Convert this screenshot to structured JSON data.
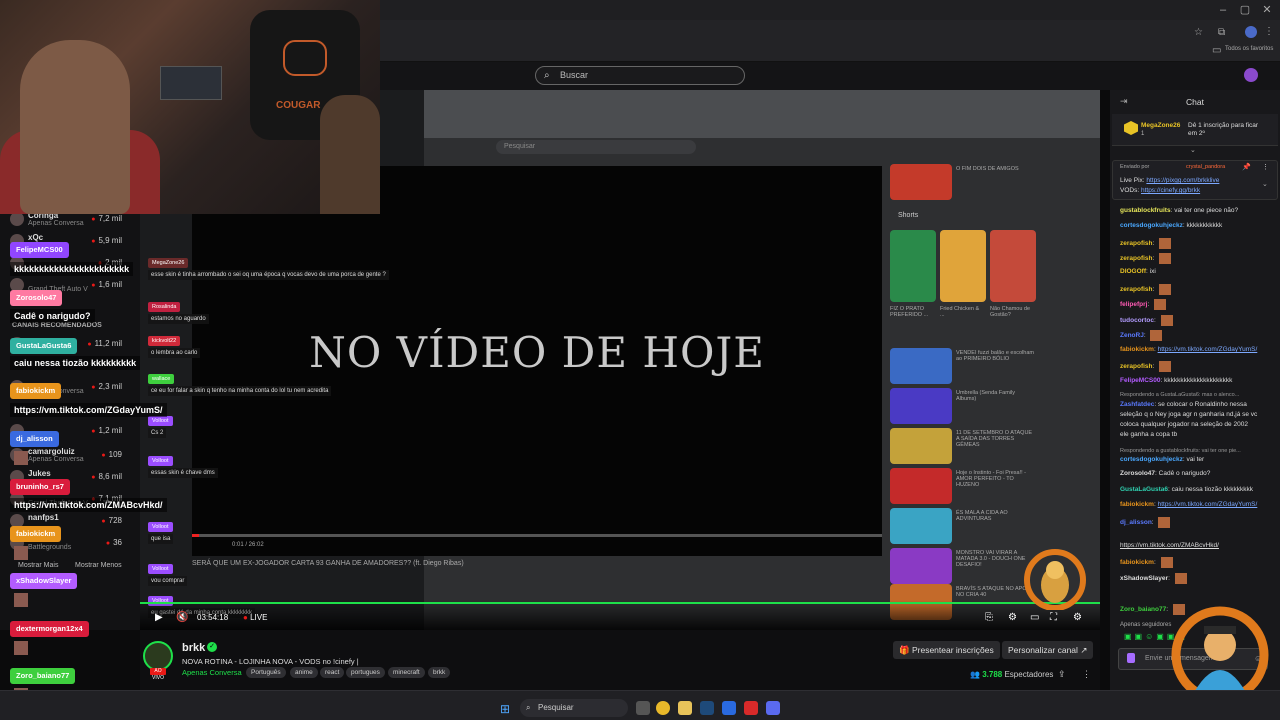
{
  "browser": {
    "window_controls": [
      "–",
      "▢",
      "✕"
    ],
    "bookmarks_label": "Todos os favoritos"
  },
  "twitch": {
    "search_placeholder": "Buscar"
  },
  "sidebar": {
    "recommended_label": "CANAIS RECOMENDADOS",
    "show_more": "Mostrar Mais",
    "show_less": "Mostrar Menos",
    "channels": [
      {
        "name": "Coringa",
        "category": "Apenas Conversa",
        "viewers": "7,2 mil"
      },
      {
        "name": "xQc",
        "category": "",
        "viewers": "5,9 mil"
      },
      {
        "name": "",
        "category": "",
        "viewers": "2 mil"
      },
      {
        "name": "",
        "category": "Grand Theft Auto V",
        "viewers": "1,6 mil"
      },
      {
        "name": "",
        "category": "",
        "viewers": "11,2 mil"
      },
      {
        "name": "",
        "category": "Apenas Conversa",
        "viewers": "2,3 mil"
      },
      {
        "name": "",
        "category": "",
        "viewers": "1,2 mil"
      },
      {
        "name": "camargoluiz",
        "category": "Apenas Conversa",
        "viewers": "109"
      },
      {
        "name": "Jukes",
        "category": "",
        "viewers": "8,6 mil"
      },
      {
        "name": "",
        "category": "Grand Theft Auto V",
        "viewers": "7,1 mil"
      },
      {
        "name": "nanfps1",
        "category": "",
        "viewers": "728"
      },
      {
        "name": "",
        "category": "Battlegrounds",
        "viewers": "36"
      }
    ]
  },
  "overlay_chat": [
    {
      "user": "FelipeMCS00",
      "color": "#9146ff",
      "message": "kkkkkkkkkkkkkkkkkkkkkkk"
    },
    {
      "user": "Zorosolo47",
      "color": "#ff7aa2",
      "message": "Cadê o narigudo?"
    },
    {
      "user": "GustaLaGusta6",
      "color": "#2fb0a0",
      "message": "caiu nessa tiozão kkkkkkkkk"
    },
    {
      "user": "fabiokickm",
      "color": "#e8941c",
      "message": "https://vm.tiktok.com/ZGdayYumS/"
    },
    {
      "user": "dj_alisson",
      "color": "#3a6ae0",
      "message": ""
    },
    {
      "user": "bruninho_rs7",
      "color": "#d91c3c",
      "message": "https://vm.tiktok.com/ZMABcvHkd/"
    },
    {
      "user": "fabiokickm",
      "color": "#e8941c",
      "message": ""
    },
    {
      "user": "xShadowSlayer",
      "color": "#b35cff",
      "message": ""
    },
    {
      "user": "dextermorgan12x4",
      "color": "#d91c3c",
      "message": ""
    },
    {
      "user": "Zoro_baiano77",
      "color": "#3ecf3e",
      "message": ""
    }
  ],
  "webcam": {
    "chair_brand": "COUGAR"
  },
  "stream": {
    "headline": "NO VÍDEO DE HOJE",
    "inner_search": "Pesquisar",
    "shorts_label": "Shorts",
    "video_time": "0:01 / 26:02",
    "video_caption": "SERÁ QUE UM EX-JOGADOR CARTA 93 GANHA DE AMADORES?? (ft. Diego Ribas)",
    "in_chat": [
      {
        "user": "MegaZone26",
        "color": "#6a2a2a",
        "message": "esse skin é tinha arrombado o sei oq uma época q vocas devo de uma porca de gente ?"
      },
      {
        "user": "Rosalinda",
        "color": "#c02040",
        "message": "estamos no aguardo"
      },
      {
        "user": "kickvolt22",
        "color": "#d02a3a",
        "message": "o lembra ao carlo"
      },
      {
        "user": "wallace",
        "color": "#3ecf3e",
        "message": "ce eu for falar a skin q tenho na minha conta do lol tu nem acredita"
      },
      {
        "user": "Volloot",
        "color": "#9b4dff",
        "message": "Cs 2"
      },
      {
        "user": "Volloot",
        "color": "#9b4dff",
        "message": "essas skin é chave dms"
      },
      {
        "user": "Volloot",
        "color": "#9b4dff",
        "message": "que isa"
      },
      {
        "user": "Volloot",
        "color": "#9b4dff",
        "message": "vou comprar"
      },
      {
        "user": "Volloot",
        "color": "#9b4dff",
        "message": "eu gastei dá da minha conta kkkkkkkk"
      }
    ],
    "thumbnails": [
      {
        "title": "O FIM DOIS DE AMIGOS",
        "color": "#c43a2a"
      },
      {
        "title": "VENDEI fuzzi balão e escolham ao PRIMEIRO BÓLIO",
        "color": "#3a6ac4"
      },
      {
        "title": "Umbrella (Senda Family Albums)",
        "color": "#4a3ac4"
      },
      {
        "title": "11 DE SETEMBRO O ATAQUE A SAÍDA DAS TORRES GÊMEAS",
        "color": "#c4a23a"
      },
      {
        "title": "Hoje o Instinto - Foi Presa!! - AMOR PERFEITO - TO HUZENO",
        "color": "#c42a2a"
      },
      {
        "title": "ÉS MALA A CIDA AO ADVINTURAS",
        "color": "#3aa4c4"
      },
      {
        "title": "MONSTRO VAI VIRAR A MATADA 3.0 - DOUCH ONE DESAFIO!",
        "color": "#8a3ac4"
      },
      {
        "title": "BRAVÍS S ATAQUE NO APOS NO CRIA 40",
        "color": "#c46a2a"
      }
    ],
    "shorts": [
      {
        "title": "FIZ O PRATO PREFERIDO ...",
        "color": "#2a8a4a"
      },
      {
        "title": "Fried Chicken & ...",
        "color": "#e0a43a"
      },
      {
        "title": "Não Chamou de Gostão?",
        "color": "#c44a3a"
      }
    ]
  },
  "player": {
    "time": "03:54:18",
    "live": "LIVE",
    "progress_fraction": 1.0
  },
  "channel": {
    "name": "brkk",
    "title": "NOVA ROTINA - LOJINHA NOVA - VODS no !cinefy |",
    "category": "Apenas Conversa",
    "live_badge": "AO VIVO",
    "tags": [
      "Português",
      "anime",
      "react",
      "portugues",
      "minecraft",
      "brkk"
    ],
    "subscribe_button": "Presentear inscrições",
    "customize_button": "Personalizar canal",
    "viewers_count": "3.788",
    "viewers_label": "Espectadores"
  },
  "chat": {
    "header": "Chat",
    "hype_user": "MegaZone26",
    "hype_sub": "1",
    "hype_message": "Dê 1 inscrição para ficar em 2º",
    "pinned_by": "Enviado por",
    "pinned_user": "crystal_pandora",
    "pinned_line1_label": "Live Pix:",
    "pinned_line1_link": "https://pixgg.com/brkklive",
    "pinned_line2_label": "VODs:",
    "pinned_line2_link": "https://cinefy.gg/brkk",
    "messages": [
      {
        "user": "gustablockfruits",
        "color": "#e6e65a",
        "text": "vai ter one piece não?"
      },
      {
        "user": "cortesdogokuhjeckz",
        "color": "#4aa8ff",
        "text": "kkkkkkkkkkk"
      },
      {
        "user": "zerapofish",
        "color": "#e8c326",
        "text": ""
      },
      {
        "user": "zerapofish",
        "color": "#e8c326",
        "text": ""
      },
      {
        "user": "DIOGOff",
        "color": "#e8c326",
        "text": "ixi"
      },
      {
        "user": "zerapofish",
        "color": "#e8c326",
        "text": ""
      },
      {
        "user": "felipefprj",
        "color": "#ff5ab4",
        "text": ""
      },
      {
        "user": "tudocortoc",
        "color": "#b39cff",
        "text": ""
      },
      {
        "user": "ZenoRJ",
        "color": "#5a7aff",
        "text": ""
      },
      {
        "user": "fabiokickm",
        "color": "#e8941c",
        "text": "https://vm.tiktok.com/ZGdayYumS/"
      },
      {
        "user": "zerapofish",
        "color": "#e8c326",
        "text": ""
      },
      {
        "user": "FelipeMCS00",
        "color": "#b35cff",
        "text": "kkkkkkkkkkkkkkkkkkkkk"
      },
      {
        "user": "Zashfatdec",
        "color": "#5a7aff",
        "text": "se colocar o Ronaldinho nessa"
      },
      {
        "user": "",
        "color": "#ddd",
        "text": "seleção q o Ney joga agr n ganharia nd,já se vc"
      },
      {
        "user": "",
        "color": "#ddd",
        "text": "coloca qualquer jogador na seleção de 2002"
      },
      {
        "user": "",
        "color": "#ddd",
        "text": "ele ganha a copa tb"
      },
      {
        "user": "cortesdogokuhjeckz",
        "color": "#4aa8ff",
        "text": "vai ter"
      },
      {
        "user": "Zorosolo47",
        "color": "#ddd",
        "text": "Cadê o narigudo?"
      },
      {
        "user": "GustaLaGusta6",
        "color": "#2fd0b0",
        "text": "caiu nessa tiozão kkkkkkkkk"
      },
      {
        "user": "fabiokickm",
        "color": "#e8941c",
        "text": "https://vm.tiktok.com/ZGdayYumS/"
      },
      {
        "user": "dj_alisson",
        "color": "#5a7aff",
        "text": ""
      },
      {
        "user": "",
        "color": "#ddd",
        "text": "https://vm.tiktok.com/ZMABcvHkd/"
      },
      {
        "user": "fabiokickm",
        "color": "#e8941c",
        "text": ""
      },
      {
        "user": "xShadowSlayer",
        "color": "#ddd",
        "text": ""
      },
      {
        "user": "Zoro_baiano77",
        "color": "#3ecf3e",
        "text": ""
      }
    ],
    "reply_label": "Respondendo a GustaLaGusta6: mas o alenco...",
    "reply_label2": "Respondendo a gustablockfruits: vai ter one pie...",
    "followers_only": "Apenas seguidores",
    "input_placeholder": "Envie uma mensagem"
  },
  "taskbar": {
    "search": "Pesquisar"
  }
}
